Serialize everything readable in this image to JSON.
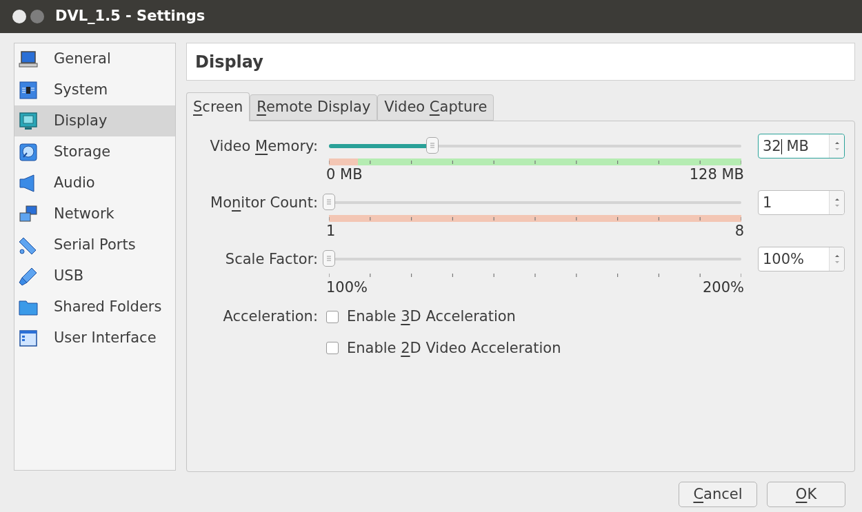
{
  "window": {
    "title": "DVL_1.5 - Settings"
  },
  "sidebar": {
    "items": [
      {
        "label": "General",
        "selected": false
      },
      {
        "label": "System",
        "selected": false
      },
      {
        "label": "Display",
        "selected": true
      },
      {
        "label": "Storage",
        "selected": false
      },
      {
        "label": "Audio",
        "selected": false
      },
      {
        "label": "Network",
        "selected": false
      },
      {
        "label": "Serial Ports",
        "selected": false
      },
      {
        "label": "USB",
        "selected": false
      },
      {
        "label": "Shared Folders",
        "selected": false
      },
      {
        "label": "User Interface",
        "selected": false
      }
    ]
  },
  "page_title": "Display",
  "tabs": [
    {
      "label": {
        "key": "S",
        "post": "creen"
      },
      "selected": true
    },
    {
      "label": {
        "key": "R",
        "post": "emote Display"
      },
      "selected": false
    },
    {
      "label": {
        "pre": "Video ",
        "key": "C",
        "post": "apture"
      },
      "selected": false
    }
  ],
  "sliders": [
    {
      "label": {
        "pre": "Video ",
        "key": "M",
        "post": "emory:"
      },
      "level": 0.25,
      "min_label": "0 MB",
      "max_label": "128 MB",
      "value": "32",
      "suffix": " MB",
      "focused": true,
      "ranges": [
        {
          "color": "#f3c6b4"
        },
        {
          "color": "#b5ecb2"
        }
      ]
    },
    {
      "label": {
        "pre": "Mo",
        "key": "n",
        "post": "itor Count:"
      },
      "level": 0,
      "min_label": "1",
      "max_label": "8",
      "value": "1",
      "focused": false,
      "ranges": [
        {
          "color": "#f3c6b4"
        }
      ]
    },
    {
      "label": {
        "post": "Scale Factor:"
      },
      "level": 0,
      "min_label": "100%",
      "max_label": "200%",
      "value": "100%",
      "focused": false
    }
  ],
  "acceleration": {
    "label": "Acceleration:",
    "options": [
      {
        "label": {
          "pre": "Enable ",
          "key": "3",
          "post": "D Acceleration"
        },
        "checked": false
      },
      {
        "label": {
          "pre": "Enable ",
          "key": "2",
          "post": "D Video Acceleration"
        },
        "checked": false
      }
    ]
  },
  "buttons": [
    {
      "label": {
        "key": "C",
        "post": "ancel"
      }
    },
    {
      "label": {
        "key": "O",
        "post": "K"
      }
    }
  ]
}
